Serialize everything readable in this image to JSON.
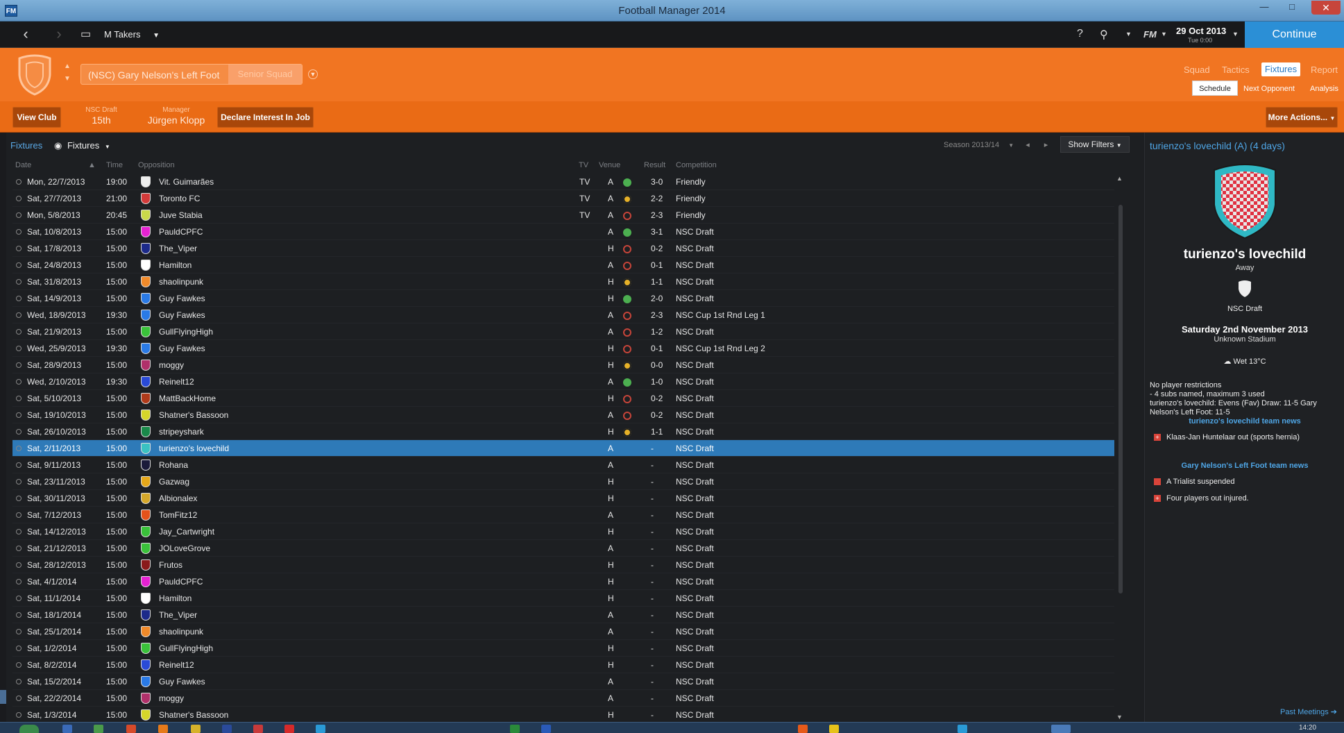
{
  "window": {
    "title": "Football Manager 2014",
    "app_icon": "FM",
    "minimize": "—",
    "maximize": "□",
    "close": "✕"
  },
  "topbar": {
    "manager": "M Takers",
    "date": "29 Oct 2013",
    "date_sub": "Tue 0:00",
    "continue_label": "Continue",
    "icons": [
      "back-icon",
      "forward-icon",
      "inbox-icon",
      "help-icon",
      "search-icon",
      "fm-menu-icon"
    ],
    "fm_label": "FM"
  },
  "header": {
    "club": "(NSC) Gary Nelson's Left Foot",
    "squad": "Senior Squad",
    "tabs": [
      "Squad",
      "Tactics",
      "Fixtures",
      "Report"
    ],
    "active_tab": "Fixtures",
    "subtabs": [
      "Schedule",
      "Next Opponent",
      "Analysis"
    ],
    "active_subtab": "Schedule",
    "accent": "#f17522"
  },
  "actionbar": {
    "view_club": "View Club",
    "league_label": "NSC Draft",
    "league_pos": "15th",
    "manager_label": "Manager",
    "manager_name": "Jürgen Klopp",
    "declare": "Declare Interest In Job",
    "more_actions": "More Actions..."
  },
  "fixtures": {
    "breadcrumb": "Fixtures",
    "view": "Fixtures",
    "season": "Season 2013/14",
    "show_filters": "Show Filters",
    "columns": {
      "date": "Date",
      "time": "Time",
      "opposition": "Opposition",
      "tv": "TV",
      "venue": "Venue",
      "result": "Result",
      "competition": "Competition"
    },
    "rows": [
      {
        "date": "Mon, 22/7/2013",
        "time": "19:00",
        "opp": "Vit. Guimarães",
        "tv": "TV",
        "venue": "A",
        "res": "win",
        "score": "3-0",
        "comp": "Friendly",
        "color": "#eeeeee"
      },
      {
        "date": "Sat, 27/7/2013",
        "time": "21:00",
        "opp": "Toronto FC",
        "tv": "TV",
        "venue": "A",
        "res": "draw",
        "score": "2-2",
        "comp": "Friendly",
        "color": "#d33a3a"
      },
      {
        "date": "Mon, 5/8/2013",
        "time": "20:45",
        "opp": "Juve Stabia",
        "tv": "TV",
        "venue": "A",
        "res": "loss",
        "score": "2-3",
        "comp": "Friendly",
        "color": "#c9d94a"
      },
      {
        "date": "Sat, 10/8/2013",
        "time": "15:00",
        "opp": "PauldCPFC",
        "tv": "",
        "venue": "A",
        "res": "win",
        "score": "3-1",
        "comp": "NSC Draft",
        "color": "#e622d2"
      },
      {
        "date": "Sat, 17/8/2013",
        "time": "15:00",
        "opp": "The_Viper",
        "tv": "",
        "venue": "H",
        "res": "loss",
        "score": "0-2",
        "comp": "NSC Draft",
        "color": "#1c2a8a"
      },
      {
        "date": "Sat, 24/8/2013",
        "time": "15:00",
        "opp": "Hamilton",
        "tv": "",
        "venue": "A",
        "res": "loss",
        "score": "0-1",
        "comp": "NSC Draft",
        "color": "#ffffff"
      },
      {
        "date": "Sat, 31/8/2013",
        "time": "15:00",
        "opp": "shaolinpunk",
        "tv": "",
        "venue": "H",
        "res": "draw",
        "score": "1-1",
        "comp": "NSC Draft",
        "color": "#f08a2a"
      },
      {
        "date": "Sat, 14/9/2013",
        "time": "15:00",
        "opp": "Guy Fawkes",
        "tv": "",
        "venue": "H",
        "res": "win",
        "score": "2-0",
        "comp": "NSC Draft",
        "color": "#2a7ae6"
      },
      {
        "date": "Wed, 18/9/2013",
        "time": "19:30",
        "opp": "Guy Fawkes",
        "tv": "",
        "venue": "A",
        "res": "loss",
        "score": "2-3",
        "comp": "NSC Cup 1st Rnd Leg 1",
        "color": "#2a7ae6"
      },
      {
        "date": "Sat, 21/9/2013",
        "time": "15:00",
        "opp": "GullFlyingHigh",
        "tv": "",
        "venue": "A",
        "res": "loss",
        "score": "1-2",
        "comp": "NSC Draft",
        "color": "#3ac23a"
      },
      {
        "date": "Wed, 25/9/2013",
        "time": "19:30",
        "opp": "Guy Fawkes",
        "tv": "",
        "venue": "H",
        "res": "loss",
        "score": "0-1",
        "comp": "NSC Cup 1st Rnd Leg 2",
        "color": "#2a7ae6"
      },
      {
        "date": "Sat, 28/9/2013",
        "time": "15:00",
        "opp": "moggy",
        "tv": "",
        "venue": "H",
        "res": "draw",
        "score": "0-0",
        "comp": "NSC Draft",
        "color": "#b0306a"
      },
      {
        "date": "Wed, 2/10/2013",
        "time": "19:30",
        "opp": "Reinelt12",
        "tv": "",
        "venue": "A",
        "res": "win",
        "score": "1-0",
        "comp": "NSC Draft",
        "color": "#2a4ad6"
      },
      {
        "date": "Sat, 5/10/2013",
        "time": "15:00",
        "opp": "MattBackHome",
        "tv": "",
        "venue": "H",
        "res": "loss",
        "score": "0-2",
        "comp": "NSC Draft",
        "color": "#b03a1a"
      },
      {
        "date": "Sat, 19/10/2013",
        "time": "15:00",
        "opp": "Shatner's Bassoon",
        "tv": "",
        "venue": "A",
        "res": "loss",
        "score": "0-2",
        "comp": "NSC Draft",
        "color": "#d6d62a"
      },
      {
        "date": "Sat, 26/10/2013",
        "time": "15:00",
        "opp": "stripeyshark",
        "tv": "",
        "venue": "H",
        "res": "draw",
        "score": "1-1",
        "comp": "NSC Draft",
        "color": "#1a8a4a"
      },
      {
        "date": "Sat, 2/11/2013",
        "time": "15:00",
        "opp": "turienzo's lovechild",
        "tv": "",
        "venue": "A",
        "res": "none",
        "score": "-",
        "comp": "NSC Draft",
        "color": "#3ac2c2",
        "selected": true
      },
      {
        "date": "Sat, 9/11/2013",
        "time": "15:00",
        "opp": "Rohana",
        "tv": "",
        "venue": "A",
        "res": "none",
        "score": "-",
        "comp": "NSC Draft",
        "color": "#1a1a3a"
      },
      {
        "date": "Sat, 23/11/2013",
        "time": "15:00",
        "opp": "Gazwag",
        "tv": "",
        "venue": "H",
        "res": "none",
        "score": "-",
        "comp": "NSC Draft",
        "color": "#e6a81a"
      },
      {
        "date": "Sat, 30/11/2013",
        "time": "15:00",
        "opp": "Albionalex",
        "tv": "",
        "venue": "H",
        "res": "none",
        "score": "-",
        "comp": "NSC Draft",
        "color": "#d6a82a"
      },
      {
        "date": "Sat, 7/12/2013",
        "time": "15:00",
        "opp": "TomFitz12",
        "tv": "",
        "venue": "A",
        "res": "none",
        "score": "-",
        "comp": "NSC Draft",
        "color": "#e6521a"
      },
      {
        "date": "Sat, 14/12/2013",
        "time": "15:00",
        "opp": "Jay_Cartwright",
        "tv": "",
        "venue": "H",
        "res": "none",
        "score": "-",
        "comp": "NSC Draft",
        "color": "#3ac23a"
      },
      {
        "date": "Sat, 21/12/2013",
        "time": "15:00",
        "opp": "JOLoveGrove",
        "tv": "",
        "venue": "A",
        "res": "none",
        "score": "-",
        "comp": "NSC Draft",
        "color": "#3ac23a"
      },
      {
        "date": "Sat, 28/12/2013",
        "time": "15:00",
        "opp": "Frutos",
        "tv": "",
        "venue": "H",
        "res": "none",
        "score": "-",
        "comp": "NSC Draft",
        "color": "#8a1a1a"
      },
      {
        "date": "Sat, 4/1/2014",
        "time": "15:00",
        "opp": "PauldCPFC",
        "tv": "",
        "venue": "H",
        "res": "none",
        "score": "-",
        "comp": "NSC Draft",
        "color": "#e622d2"
      },
      {
        "date": "Sat, 11/1/2014",
        "time": "15:00",
        "opp": "Hamilton",
        "tv": "",
        "venue": "H",
        "res": "none",
        "score": "-",
        "comp": "NSC Draft",
        "color": "#ffffff"
      },
      {
        "date": "Sat, 18/1/2014",
        "time": "15:00",
        "opp": "The_Viper",
        "tv": "",
        "venue": "A",
        "res": "none",
        "score": "-",
        "comp": "NSC Draft",
        "color": "#1c2a8a"
      },
      {
        "date": "Sat, 25/1/2014",
        "time": "15:00",
        "opp": "shaolinpunk",
        "tv": "",
        "venue": "A",
        "res": "none",
        "score": "-",
        "comp": "NSC Draft",
        "color": "#f08a2a"
      },
      {
        "date": "Sat, 1/2/2014",
        "time": "15:00",
        "opp": "GullFlyingHigh",
        "tv": "",
        "venue": "H",
        "res": "none",
        "score": "-",
        "comp": "NSC Draft",
        "color": "#3ac23a"
      },
      {
        "date": "Sat, 8/2/2014",
        "time": "15:00",
        "opp": "Reinelt12",
        "tv": "",
        "venue": "H",
        "res": "none",
        "score": "-",
        "comp": "NSC Draft",
        "color": "#2a4ad6"
      },
      {
        "date": "Sat, 15/2/2014",
        "time": "15:00",
        "opp": "Guy Fawkes",
        "tv": "",
        "venue": "A",
        "res": "none",
        "score": "-",
        "comp": "NSC Draft",
        "color": "#2a7ae6"
      },
      {
        "date": "Sat, 22/2/2014",
        "time": "15:00",
        "opp": "moggy",
        "tv": "",
        "venue": "A",
        "res": "none",
        "score": "-",
        "comp": "NSC Draft",
        "color": "#b0306a"
      },
      {
        "date": "Sat, 1/3/2014",
        "time": "15:00",
        "opp": "Shatner's Bassoon",
        "tv": "",
        "venue": "H",
        "res": "none",
        "score": "-",
        "comp": "NSC Draft",
        "color": "#d6d62a"
      }
    ]
  },
  "panel": {
    "title": "turienzo's lovechild (A) (4 days)",
    "team": "turienzo's lovechild",
    "venue": "Away",
    "competition": "NSC Draft",
    "date": "Saturday 2nd November 2013",
    "stadium": "Unknown Stadium",
    "weather": "Wet 13°C",
    "notes": [
      "No player restrictions",
      "- 4 subs named, maximum 3 used",
      "turienzo's lovechild: Evens (Fav) Draw: 11-5 Gary Nelson's Left Foot: 11-5"
    ],
    "opp_news_title": "turienzo's lovechild team news",
    "opp_news": [
      "Klaas-Jan Huntelaar out (sports hernia)"
    ],
    "own_news_title": "Gary Nelson's Left Foot team news",
    "own_news": [
      "A Trialist suspended",
      "Four players out injured."
    ],
    "past_meetings": "Past Meetings ➔"
  },
  "taskbar": {
    "time": "14:20"
  }
}
